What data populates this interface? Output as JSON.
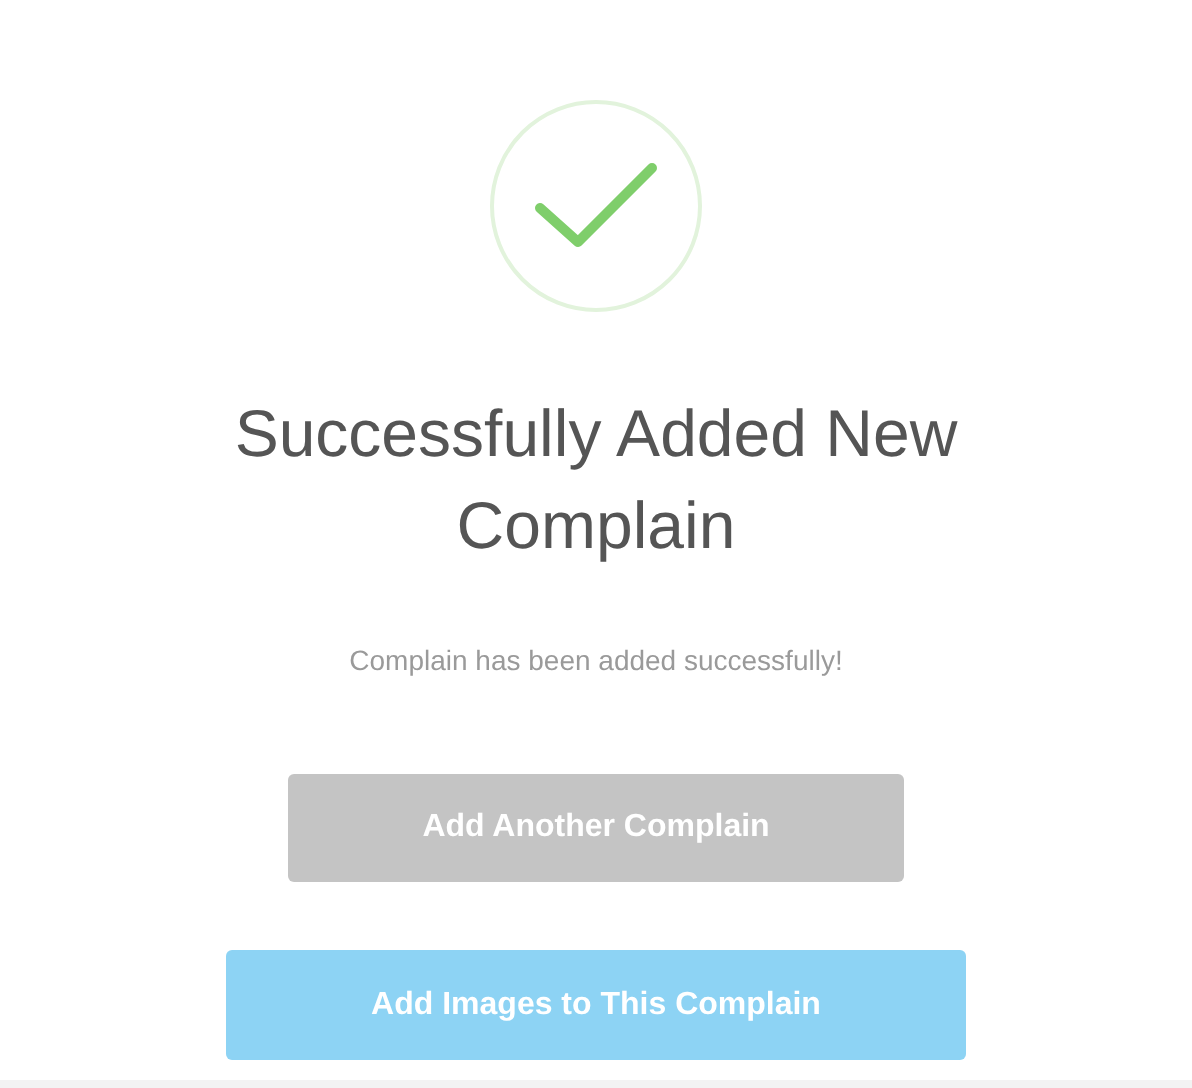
{
  "title": "Successfully Added New Complain",
  "message": "Complain has been added successfully!",
  "buttons": [
    {
      "label": "Add Another Complain",
      "kind": "secondary"
    },
    {
      "label": "Add Images to This Complain",
      "kind": "primary"
    }
  ]
}
